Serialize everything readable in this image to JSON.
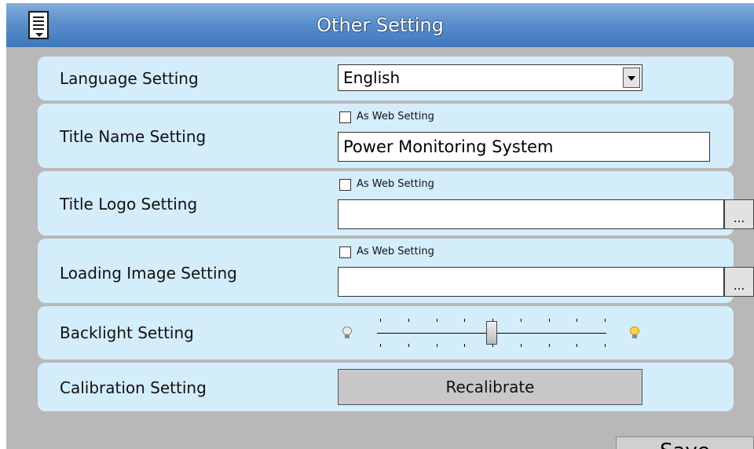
{
  "window": {
    "title": "Other Setting"
  },
  "icons": {
    "menu": "menu-icon",
    "browse": "ellipsis-icon",
    "brightness_low": "dim-bulb-icon",
    "brightness_high": "bright-bulb-icon"
  },
  "colors": {
    "titlebar": "#4f86c6",
    "row_background": "#d4edfb",
    "window_background": "#b8b8b8"
  },
  "settings": {
    "language": {
      "label": "Language Setting",
      "selected": "English"
    },
    "title_name": {
      "label": "Title Name Setting",
      "checkbox_label": "As Web Setting",
      "checked": false,
      "value": "Power Monitoring System"
    },
    "title_logo": {
      "label": "Title Logo Setting",
      "checkbox_label": "As Web Setting",
      "checked": false,
      "value": "",
      "browse_label": "..."
    },
    "loading_image": {
      "label": "Loading Image Setting",
      "checkbox_label": "As Web Setting",
      "checked": false,
      "value": "",
      "browse_label": "..."
    },
    "backlight": {
      "label": "Backlight Setting",
      "level": 0.5,
      "ticks": 9
    },
    "calibration": {
      "label": "Calibration Setting",
      "button_label": "Recalibrate"
    }
  },
  "footer": {
    "save_label": "Save"
  }
}
